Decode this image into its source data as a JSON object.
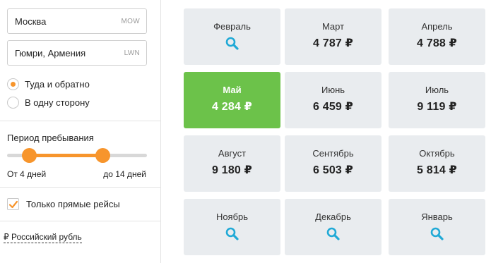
{
  "search": {
    "origin": {
      "city": "Москва",
      "code": "MOW"
    },
    "destination": {
      "city": "Гюмри, Армения",
      "code": "LWN"
    }
  },
  "trip_type": {
    "options": [
      "Туда и обратно",
      "В одну сторону"
    ],
    "selected": "Туда и обратно"
  },
  "stay": {
    "title": "Период пребывания",
    "min_label": "От 4 дней",
    "max_label": "до 14 дней",
    "min_days": 4,
    "max_days": 14
  },
  "filters": {
    "direct_only_label": "Только прямые рейсы",
    "direct_only_checked": true
  },
  "currency": {
    "label": "₽ Российский рубль"
  },
  "colors": {
    "accent": "#f7952c",
    "active_month": "#6cc24a",
    "search_icon": "#1fa9d6"
  },
  "months": [
    {
      "name": "Февраль",
      "price": null
    },
    {
      "name": "Март",
      "price": "4 787 ₽"
    },
    {
      "name": "Апрель",
      "price": "4 788 ₽"
    },
    {
      "name": "Май",
      "price": "4 284 ₽",
      "active": true
    },
    {
      "name": "Июнь",
      "price": "6 459 ₽"
    },
    {
      "name": "Июль",
      "price": "9 119 ₽"
    },
    {
      "name": "Август",
      "price": "9 180 ₽"
    },
    {
      "name": "Сентябрь",
      "price": "6 503 ₽"
    },
    {
      "name": "Октябрь",
      "price": "5 814 ₽"
    },
    {
      "name": "Ноябрь",
      "price": null
    },
    {
      "name": "Декабрь",
      "price": null
    },
    {
      "name": "Январь",
      "price": null
    }
  ]
}
